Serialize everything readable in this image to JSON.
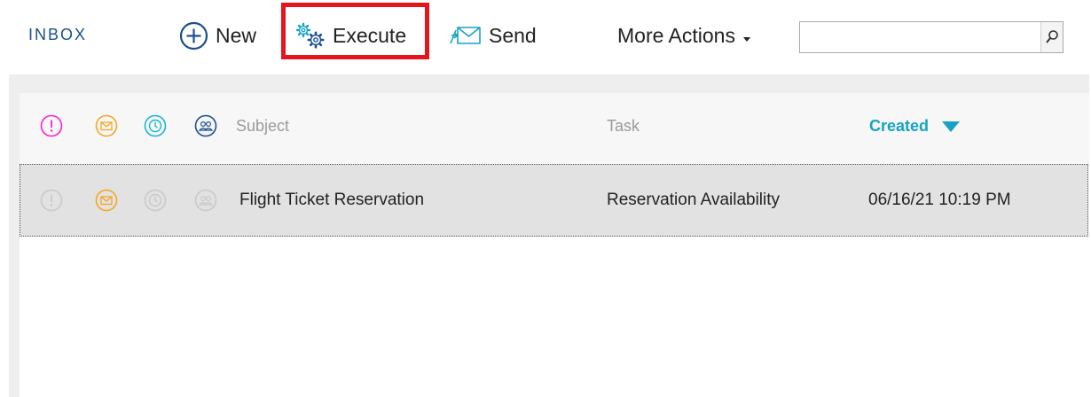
{
  "toolbar": {
    "title": "INBOX",
    "new_label": "New",
    "execute_label": "Execute",
    "send_label": "Send",
    "more_actions_label": "More Actions",
    "search_value": "",
    "search_placeholder": ""
  },
  "grid": {
    "columns": {
      "subject": "Subject",
      "task": "Task",
      "created": "Created"
    },
    "sort": {
      "column": "created",
      "direction": "descending"
    },
    "rows": [
      {
        "subject": "Flight Ticket Reservation",
        "task": "Reservation Availability",
        "created": "06/16/21 10:19 PM"
      }
    ]
  },
  "colors": {
    "priority": "#ff1fcf",
    "mail": "#f5a623",
    "time": "#18b6d1",
    "group": "#1b4f8f",
    "accent": "#17a3c4",
    "highlight": "#e3161e"
  }
}
